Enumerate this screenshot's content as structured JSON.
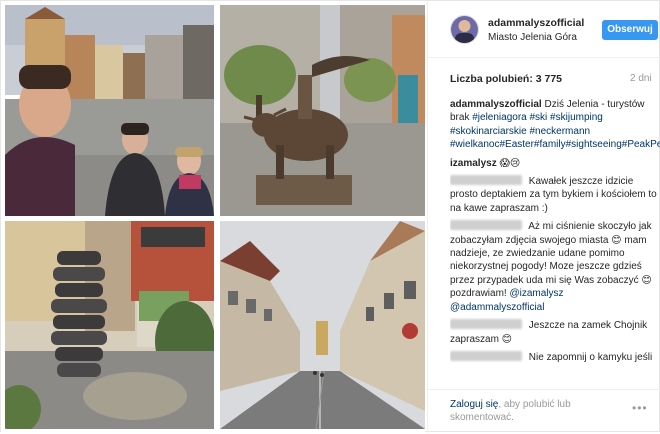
{
  "header": {
    "username": "adammalyszofficial",
    "location": "Miasto Jelenia Góra",
    "follow_label": "Obserwuj"
  },
  "stats": {
    "likes": "Liczba polubień: 3 775",
    "time": "2 dni"
  },
  "caption": {
    "user": "adammalyszofficial",
    "text": "Dziś Jelenia - turystów brak",
    "tags": "#jeleniagora #ski #skijumping #skokinarciarskie #neckermann #wielkanoc#Easter#family#sightseeing#PeakPerformance"
  },
  "comments": [
    {
      "user": "izamalysz",
      "text": "😱😢"
    },
    {
      "user": "",
      "text": "Kawałek jeszcze idzicie prosto deptakiem za tym bykiem i kościołem to na kawe zapraszam :)"
    },
    {
      "user": "",
      "text": "Aż mi ciśnienie skoczyło jak zobaczyłam zdjęcia swojego miasta 😊 mam nadzieje, ze zwiedzanie udane pomimo niekorzystnej pogody! Moze jeszcze gdzieś przez przypadek uda mi się Was zobaczyć 😊 pozdrawiam!",
      "mentions": "@izamalysz @adammalyszofficial"
    },
    {
      "user": "",
      "text": "Jeszcze na zamek Chojnik zapraszam 😊"
    },
    {
      "user": "",
      "text": "Nie zapomnij o kamyku jeśli"
    }
  ],
  "footer": {
    "login_link": "Zaloguj się",
    "login_rest": ", aby polubić lub skomentować.",
    "more_label": "•••"
  },
  "icons": {
    "avatar": "profile-avatar",
    "more": "more-options-icon"
  },
  "colors": {
    "accent": "#3897f0",
    "link": "#003569",
    "muted": "#999999"
  }
}
